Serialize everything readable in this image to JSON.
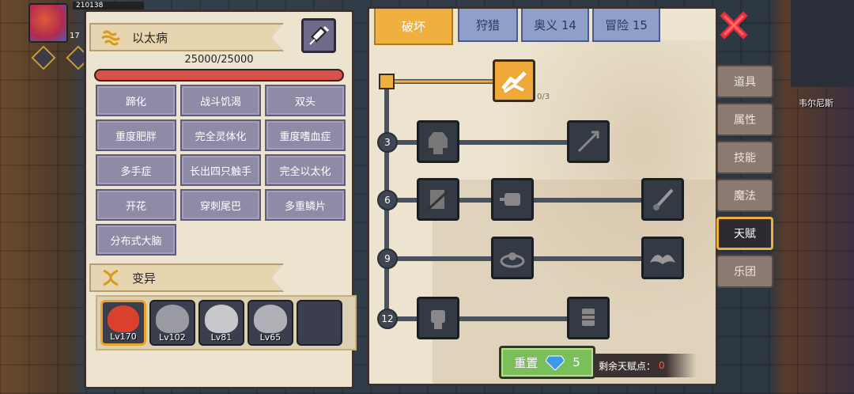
{
  "hud": {
    "hp_text": "210138",
    "level": "17"
  },
  "disease": {
    "title": "以太病",
    "hp_text": "25000/25000",
    "hp_fraction": 1.0,
    "traits": [
      "蹄化",
      "战斗饥渴",
      "双头",
      "重度肥胖",
      "完全灵体化",
      "重度嗜血症",
      "多手症",
      "长出四只触手",
      "完全以太化",
      "开花",
      "穿刺尾巴",
      "多重鳞片",
      "分布式大脑"
    ]
  },
  "mutation": {
    "title": "变异",
    "slots": [
      {
        "level": "Lv170",
        "active": true,
        "color": "#d9402e"
      },
      {
        "level": "Lv102",
        "active": false,
        "color": "#9a9aa2"
      },
      {
        "level": "Lv81",
        "active": false,
        "color": "#c8c8cc"
      },
      {
        "level": "Lv65",
        "active": false,
        "color": "#b0b0b6"
      },
      {
        "level": "",
        "active": false,
        "color": ""
      }
    ]
  },
  "talent_tabs": [
    {
      "label": "破坏",
      "active": true
    },
    {
      "label": "狩猎",
      "active": false
    },
    {
      "label": "奥义 14",
      "active": false
    },
    {
      "label": "冒险 15",
      "active": false
    }
  ],
  "talent_tree": {
    "root_count": "0/3",
    "tier_levels": [
      "3",
      "6",
      "9",
      "12"
    ]
  },
  "reset": {
    "label": "重置",
    "cost": "5"
  },
  "remaining": {
    "label": "剩余天赋点：",
    "value": "0"
  },
  "side_tabs": [
    {
      "label": "道具",
      "active": false
    },
    {
      "label": "属性",
      "active": false
    },
    {
      "label": "技能",
      "active": false
    },
    {
      "label": "魔法",
      "active": false
    },
    {
      "label": "天赋",
      "active": true
    },
    {
      "label": "乐团",
      "active": false
    }
  ],
  "npc_name": "韦尔尼斯",
  "colors": {
    "accent": "#f0b040",
    "hp_fill": "#d8524a",
    "trait_bg": "#8f8ba6",
    "reset_green": "#7bbf5a"
  }
}
